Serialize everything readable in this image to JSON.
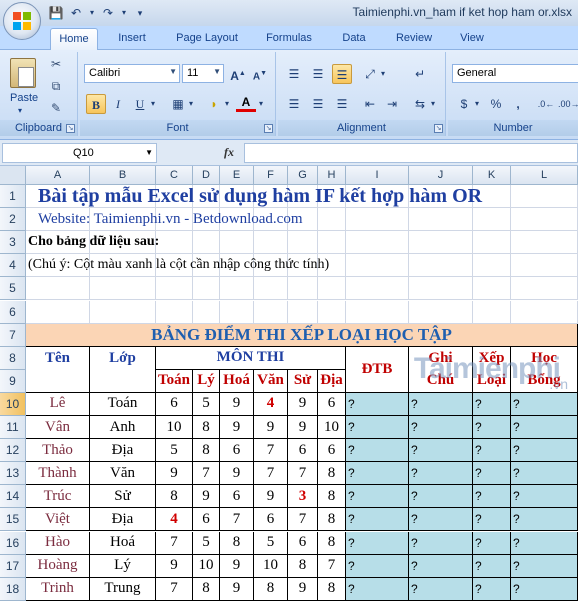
{
  "window": {
    "title": "Taimienphi.vn_ham if ket hop ham or.xlsx"
  },
  "qat": {
    "save_icon": "save-icon",
    "undo_icon": "undo-icon",
    "redo_icon": "redo-icon",
    "customize_icon": "customize-qat-icon"
  },
  "tabs": [
    {
      "label": "Home"
    },
    {
      "label": "Insert"
    },
    {
      "label": "Page Layout"
    },
    {
      "label": "Formulas"
    },
    {
      "label": "Data"
    },
    {
      "label": "Review"
    },
    {
      "label": "View"
    }
  ],
  "ribbon": {
    "clipboard": {
      "paste_label": "Paste",
      "group_label": "Clipboard"
    },
    "font": {
      "font_name": "Calibri",
      "font_size": "11",
      "group_label": "Font"
    },
    "alignment": {
      "group_label": "Alignment"
    },
    "number": {
      "format": "General",
      "group_label": "Number"
    }
  },
  "formula_bar": {
    "name_box": "Q10",
    "fx": "fx",
    "formula": ""
  },
  "columns": [
    "A",
    "B",
    "C",
    "D",
    "E",
    "F",
    "G",
    "H",
    "I",
    "J",
    "K",
    "L"
  ],
  "rows": [
    "1",
    "2",
    "3",
    "4",
    "5",
    "6",
    "7",
    "8",
    "9",
    "10",
    "11",
    "12",
    "13",
    "14",
    "15",
    "16",
    "17",
    "18"
  ],
  "sheet": {
    "title": "Bài tập mẫu Excel sử dụng hàm IF kết hợp hàm OR",
    "website": "Website: Taimienphi.vn - Betdownload.com",
    "prompt": "Cho bảng dữ liệu sau:",
    "note": "(Chú ý: Cột màu xanh là cột cần nhập công thức tính)",
    "table_title": "BẢNG ĐIỂM THI XẾP LOẠI HỌC TẬP",
    "headers": {
      "ten": "Tên",
      "lop": "Lớp",
      "mon_thi": "MÔN THI",
      "dtb": "ĐTB",
      "ghi": "Ghi",
      "chu": "Chú",
      "xep": "Xếp",
      "loai": "Loại",
      "hoc": "Học",
      "bong": "Bổng",
      "subjects": [
        "Toán",
        "Lý",
        "Hoá",
        "Văn",
        "Sử",
        "Địa"
      ]
    },
    "students": [
      {
        "name": "Lê",
        "class": "Toán",
        "scores": [
          "6",
          "5",
          "9",
          "4",
          "9",
          "6"
        ]
      },
      {
        "name": "Vân",
        "class": "Anh",
        "scores": [
          "10",
          "8",
          "9",
          "9",
          "9",
          "10"
        ]
      },
      {
        "name": "Thảo",
        "class": "Địa",
        "scores": [
          "5",
          "8",
          "6",
          "7",
          "6",
          "6"
        ]
      },
      {
        "name": "Thành",
        "class": "Văn",
        "scores": [
          "9",
          "7",
          "9",
          "7",
          "7",
          "8"
        ]
      },
      {
        "name": "Trúc",
        "class": "Sử",
        "scores": [
          "8",
          "9",
          "6",
          "9",
          "3",
          "8"
        ]
      },
      {
        "name": "Việt",
        "class": "Địa",
        "scores": [
          "4",
          "6",
          "7",
          "6",
          "7",
          "8"
        ]
      },
      {
        "name": "Hào",
        "class": "Hoá",
        "scores": [
          "7",
          "5",
          "8",
          "5",
          "6",
          "8"
        ]
      },
      {
        "name": "Hoàng",
        "class": "Lý",
        "scores": [
          "9",
          "10",
          "9",
          "10",
          "8",
          "7"
        ]
      },
      {
        "name": "Trinh",
        "class": "Trung",
        "scores": [
          "7",
          "8",
          "9",
          "8",
          "9",
          "8"
        ]
      }
    ],
    "placeholder": "?"
  },
  "watermark": {
    "main": "Taimienphi",
    "sub": ".vn"
  },
  "colors": {
    "accent": "#1f3fa1",
    "highlight": "#d00000",
    "formula_cols": "#b7dee8",
    "table_title_bg": "#fbd5b5"
  }
}
